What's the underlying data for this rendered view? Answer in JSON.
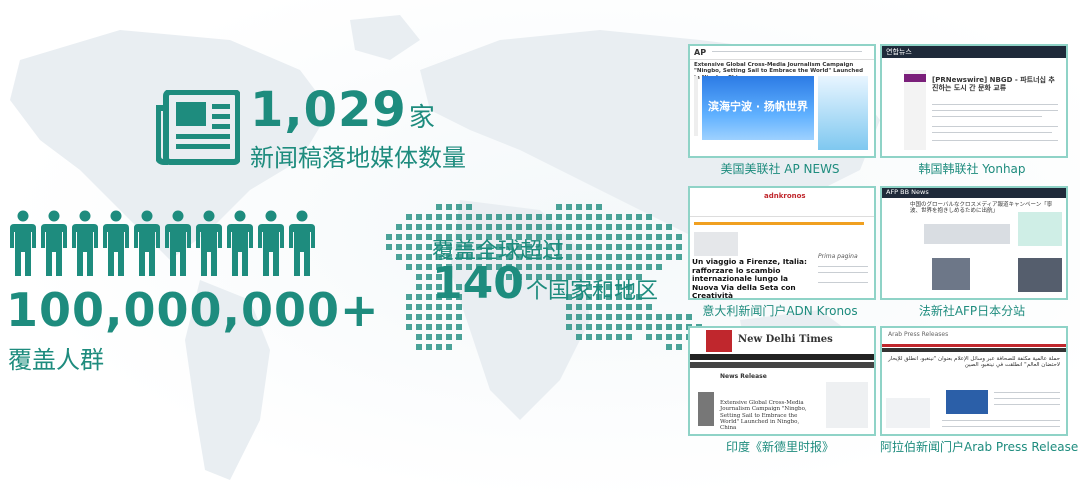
{
  "stats": {
    "media_count": "1,029",
    "media_unit": "家",
    "media_label": "新闻稿落地媒体数量",
    "audience_count": "100,000,000+",
    "audience_label": "覆盖人群",
    "coverage_prefix": "覆盖全球超过",
    "coverage_number": "140",
    "coverage_suffix": "个国家和地区"
  },
  "outlets": [
    {
      "caption": "美国美联社 AP NEWS",
      "logo": "AP",
      "headline": "Extensive Global Cross-Media Journalism Campaign \"Ningbo, Setting Sail to Embrace the World\" Launched in Ningbo, China",
      "banner": "滨海宁波 · 扬帆世界"
    },
    {
      "caption": "韩国韩联社 Yonhap",
      "logo": "연합뉴스",
      "headline": "[PRNewswire] NBGD - 파트너십 추진하는 도시 간 문화 교류"
    },
    {
      "caption": "意大利新闻门户ADN Kronos",
      "logo": "adnkronos",
      "headline": "Un viaggio a Firenze, Italia: rafforzare lo scambio internazionale lungo la Nuova Via della Seta con Creatività",
      "side": "Prima pagina"
    },
    {
      "caption": "法新社AFP日本分站",
      "logo": "AFP BB News",
      "headline": "中国のグローバルなクロスメディア報道キャンペーン「寧波、世界を抱きしめるために出航」"
    },
    {
      "caption": "印度《新德里时报》",
      "logo": "New Delhi Times",
      "headline": "Extensive Global Cross-Media Journalism Campaign \"Ningbo, Setting Sail to Embrace the World\" Launched in Ningbo, China",
      "section": "News Release"
    },
    {
      "caption": "阿拉伯新闻门户Arab Press Release",
      "logo": "Arab Press Releases",
      "headline": "حملة عالمية مكثفة للصحافة عبر وسائل الإعلام بعنوان \"نينغبو، انطلق للإبحار لاحتضان العالم\" انطلقت في نينغبو، الصين"
    }
  ],
  "colors": {
    "accent": "#1e8c7e",
    "frame": "#8fd3c7",
    "map": "#e6ecf0"
  }
}
